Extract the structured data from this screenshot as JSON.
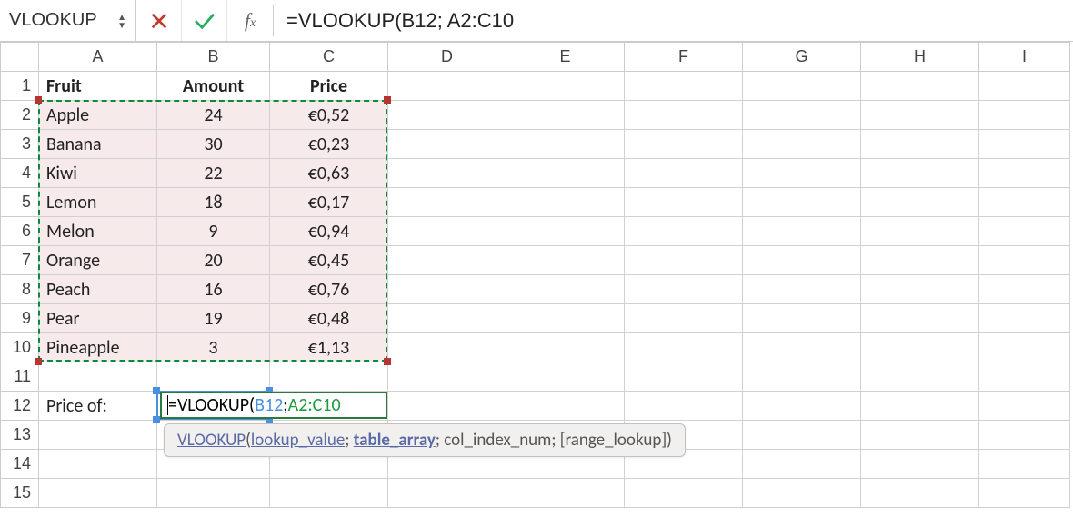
{
  "formula_bar": {
    "name_box": "VLOOKUP",
    "fx_label": "fx",
    "formula": "=VLOOKUP(B12; A2:C10"
  },
  "columns": [
    "A",
    "B",
    "C",
    "D",
    "E",
    "F",
    "G",
    "H",
    "I"
  ],
  "rows": [
    "1",
    "2",
    "3",
    "4",
    "5",
    "6",
    "7",
    "8",
    "9",
    "10",
    "11",
    "12",
    "13",
    "14",
    "15"
  ],
  "cells": {
    "A1": "Fruit",
    "B1": "Amount",
    "C1": "Price",
    "A2": "Apple",
    "B2": "24",
    "C2": "€0,52",
    "A3": "Banana",
    "B3": "30",
    "C3": "€0,23",
    "A4": "Kiwi",
    "B4": "22",
    "C4": "€0,63",
    "A5": "Lemon",
    "B5": "18",
    "C5": "€0,17",
    "A6": "Melon",
    "B6": "9",
    "C6": "€0,94",
    "A7": "Orange",
    "B7": "20",
    "C7": "€0,45",
    "A8": "Peach",
    "B8": "16",
    "C8": "€0,76",
    "A9": "Pear",
    "B9": "19",
    "C9": "€0,48",
    "A10": "Pineapple",
    "B10": "3",
    "C10": "€1,13",
    "A12": "Price of:"
  },
  "edit_cell": {
    "prefix": "=VLOOKUP(",
    "arg1": "B12",
    "sep": "; ",
    "arg2": "A2:C10"
  },
  "tooltip": {
    "fn": "VLOOKUP",
    "lp": "(",
    "a1": "lookup_value",
    "s1": "; ",
    "a2": "table_array",
    "s2": "; col_index_num; [range_lookup])"
  }
}
